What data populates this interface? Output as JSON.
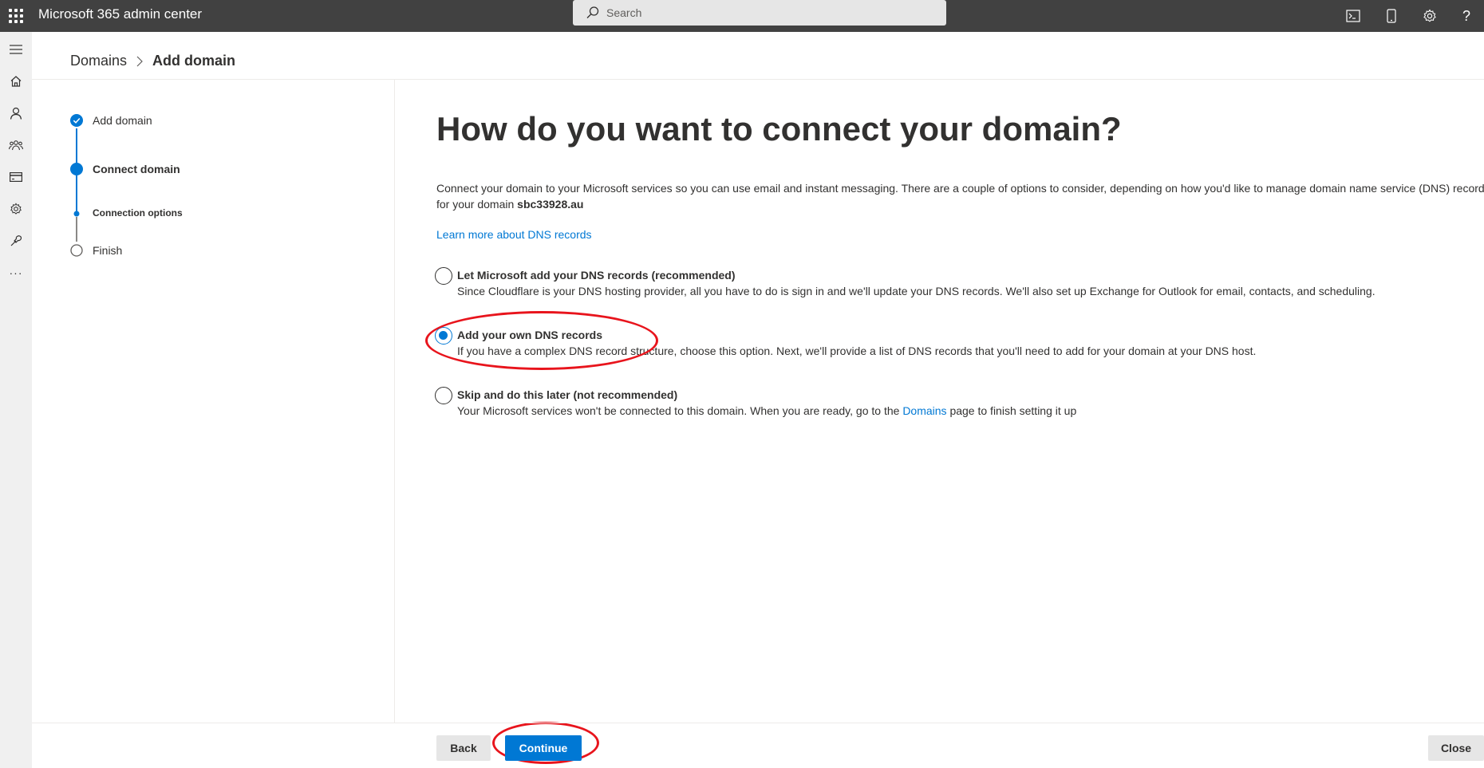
{
  "header": {
    "app_title": "Microsoft 365 admin center",
    "search_placeholder": "Search",
    "icons": [
      "waffle-icon",
      "terminal-icon",
      "mobile-icon",
      "gear-icon",
      "help-icon"
    ]
  },
  "leftnav": {
    "icons": [
      "menu-icon",
      "home-icon",
      "user-icon",
      "teams-icon",
      "billing-icon",
      "settings-icon",
      "setup-icon",
      "more-icon"
    ]
  },
  "breadcrumb": {
    "parent": "Domains",
    "current": "Add domain"
  },
  "steps": [
    {
      "label": "Add domain",
      "state": "completed"
    },
    {
      "label": "Connect domain",
      "state": "current"
    },
    {
      "label": "Connection options",
      "state": "current-substep"
    },
    {
      "label": "Finish",
      "state": "pending"
    }
  ],
  "main": {
    "title": "How do you want to connect your domain?",
    "description_line1": "Connect your domain to your Microsoft services so you can use email and instant messaging. There are a couple of options to consider, depending on how you'd like to manage domain name service (DNS) records",
    "description_line2_prefix": "for your domain ",
    "domain_name": "sbc33928.au",
    "learn_more": "Learn more about DNS records"
  },
  "options": [
    {
      "title": "Let Microsoft add your DNS records (recommended)",
      "description": "Since Cloudflare is your DNS hosting provider, all you have to do is sign in and we'll update your DNS records. We'll also set up Exchange for Outlook for email, contacts, and scheduling.",
      "checked": false
    },
    {
      "title": "Add your own DNS records",
      "description": "If you have a complex DNS record structure, choose this option. Next, we'll provide a list of DNS records that you'll need to add for your domain at your DNS host.",
      "checked": true
    },
    {
      "title": "Skip and do this later (not recommended)",
      "description_prefix": "Your Microsoft services won't be connected to this domain. When you are ready, go to the ",
      "description_link": "Domains",
      "description_suffix": " page to finish setting it up",
      "checked": false
    }
  ],
  "footer": {
    "back": "Back",
    "continue": "Continue",
    "close": "Close"
  },
  "colors": {
    "accent": "#0078d4",
    "topbar": "#414141",
    "annotation": "#e8141c"
  }
}
